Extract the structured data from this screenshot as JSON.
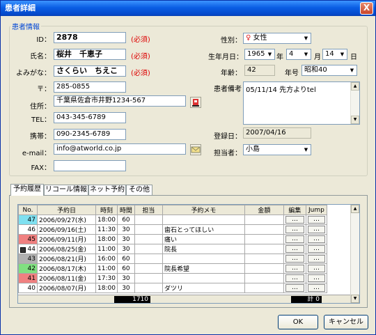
{
  "window": {
    "title": "患者詳細",
    "close_glyph": "X"
  },
  "group_title": "患者情報",
  "fields": {
    "id": {
      "label": "ID：",
      "value": "2878",
      "required": "(必須)"
    },
    "name": {
      "label": "氏名：",
      "value": "桜井　千恵子",
      "required": "(必須)"
    },
    "kana": {
      "label": "よみがな：",
      "value": "さくらい　ちえこ",
      "required": "(必須)"
    },
    "zip": {
      "label": "〒：",
      "value": "285-0855"
    },
    "address": {
      "label": "住所：",
      "value": "千葉県佐倉市井野1234-567"
    },
    "tel": {
      "label": "TEL：",
      "value": "043-345-6789"
    },
    "mobile": {
      "label": "携帯：",
      "value": "090-2345-6789"
    },
    "email": {
      "label": "e-mail：",
      "value": "info@atworld.co.jp"
    },
    "fax": {
      "label": "FAX：",
      "value": ""
    },
    "gender": {
      "label": "性別：",
      "value": "女性"
    },
    "birth": {
      "label": "生年月日：",
      "year": "1965",
      "year_unit": "年",
      "month": "4",
      "month_unit": "月",
      "day": "14",
      "day_unit": "日"
    },
    "age": {
      "label": "年齢：",
      "value": "42"
    },
    "era": {
      "label": "年号",
      "value": "昭和40"
    },
    "notes": {
      "label": "患者備考",
      "value": "05/11/14 先方よりtel"
    },
    "registered": {
      "label": "登録日：",
      "value": "2007/04/16"
    },
    "staff": {
      "label": "担当者：",
      "value": "小島"
    }
  },
  "tabs": [
    "予約履歴",
    "リコール情報",
    "ネット予約",
    "その他"
  ],
  "grid": {
    "columns": [
      "No.",
      "予約日",
      "時刻",
      "時間",
      "担当",
      "予約メモ",
      "金額",
      "編集",
      "Jump"
    ],
    "button_text": "…",
    "rows": [
      {
        "no": "47",
        "date": "2006/09/27(水)",
        "time": "18:00",
        "dur": "60",
        "staff": "",
        "memo": "",
        "amount": "",
        "color": "#7fe0f0",
        "icon": false
      },
      {
        "no": "46",
        "date": "2006/09/16(土)",
        "time": "11:30",
        "dur": "30",
        "staff": "",
        "memo": "歯石とってほしい",
        "amount": "",
        "color": "#ffffff",
        "icon": false
      },
      {
        "no": "45",
        "date": "2006/09/11(月)",
        "time": "18:00",
        "dur": "30",
        "staff": "",
        "memo": "痛い",
        "amount": "",
        "color": "#f08080",
        "icon": false
      },
      {
        "no": "44",
        "date": "2006/08/25(金)",
        "time": "11:00",
        "dur": "30",
        "staff": "",
        "memo": "院長",
        "amount": "",
        "color": "#ffffff",
        "icon": true
      },
      {
        "no": "43",
        "date": "2006/08/21(月)",
        "time": "16:00",
        "dur": "60",
        "staff": "",
        "memo": "",
        "amount": "",
        "color": "#b0b0b0",
        "icon": false
      },
      {
        "no": "42",
        "date": "2006/08/17(木)",
        "time": "11:00",
        "dur": "60",
        "staff": "",
        "memo": "院長希望",
        "amount": "",
        "color": "#80e080",
        "icon": false
      },
      {
        "no": "41",
        "date": "2006/08/11(金)",
        "time": "17:30",
        "dur": "30",
        "staff": "",
        "memo": "",
        "amount": "",
        "color": "#f08080",
        "icon": false
      },
      {
        "no": "40",
        "date": "2006/08/07(月)",
        "time": "18:00",
        "dur": "30",
        "staff": "",
        "memo": "ダツリ",
        "amount": "",
        "color": "#ffffff",
        "icon": false
      }
    ],
    "total_minutes": "1710",
    "total_amount": "計 0"
  },
  "buttons": {
    "ok": "OK",
    "cancel": "キャンセル"
  },
  "colors": {
    "title_bar": "#0a5ee4",
    "required": "#dd0000",
    "group_title": "#0046d5"
  }
}
